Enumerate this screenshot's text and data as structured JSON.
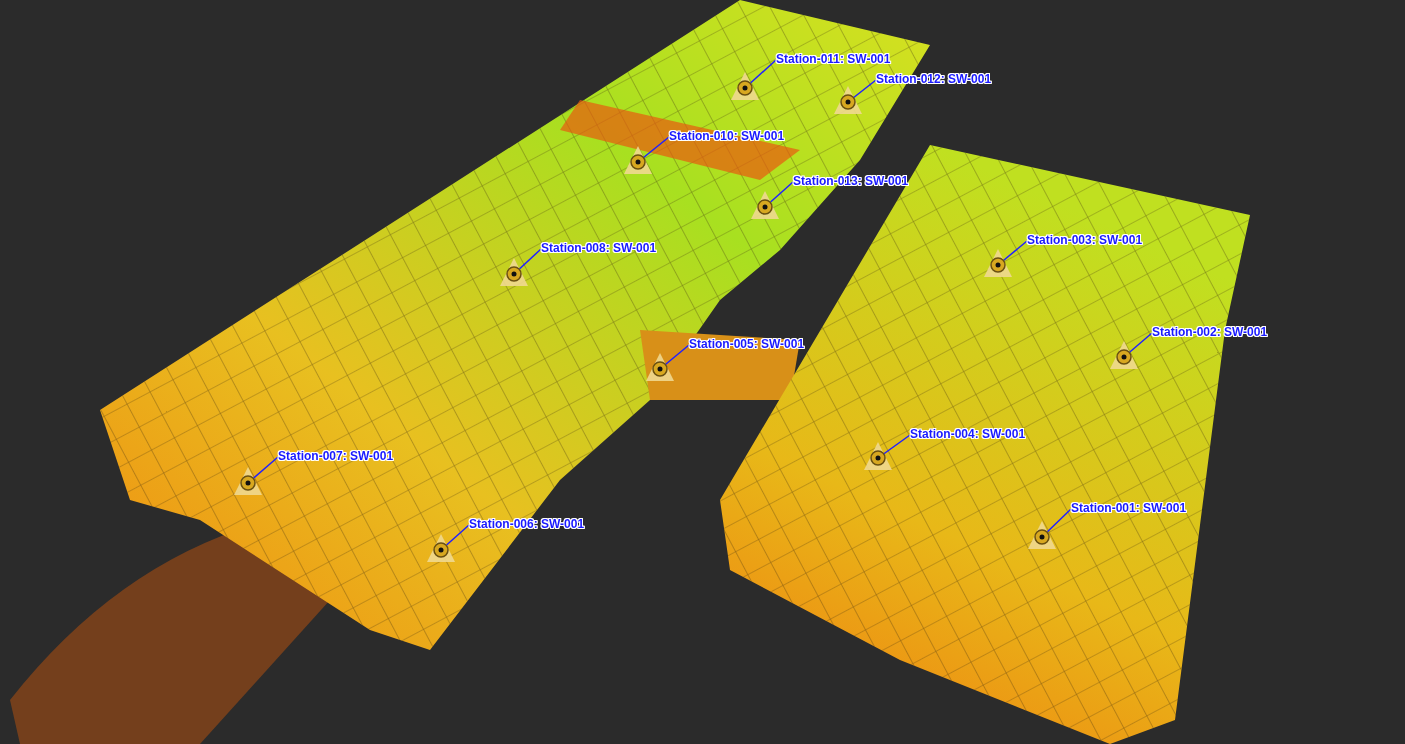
{
  "stations": [
    {
      "label": "Station-011: SW-001"
    },
    {
      "label": "Station-012: SW-001"
    },
    {
      "label": "Station-010: SW-001"
    },
    {
      "label": "Station-013: SW-001"
    },
    {
      "label": "Station-008: SW-001"
    },
    {
      "label": "Station-003: SW-001"
    },
    {
      "label": "Station-002: SW-001"
    },
    {
      "label": "Station-005: SW-001"
    },
    {
      "label": "Station-004: SW-001"
    },
    {
      "label": "Station-007: SW-001"
    },
    {
      "label": "Station-001: SW-001"
    },
    {
      "label": "Station-006: SW-001"
    }
  ]
}
